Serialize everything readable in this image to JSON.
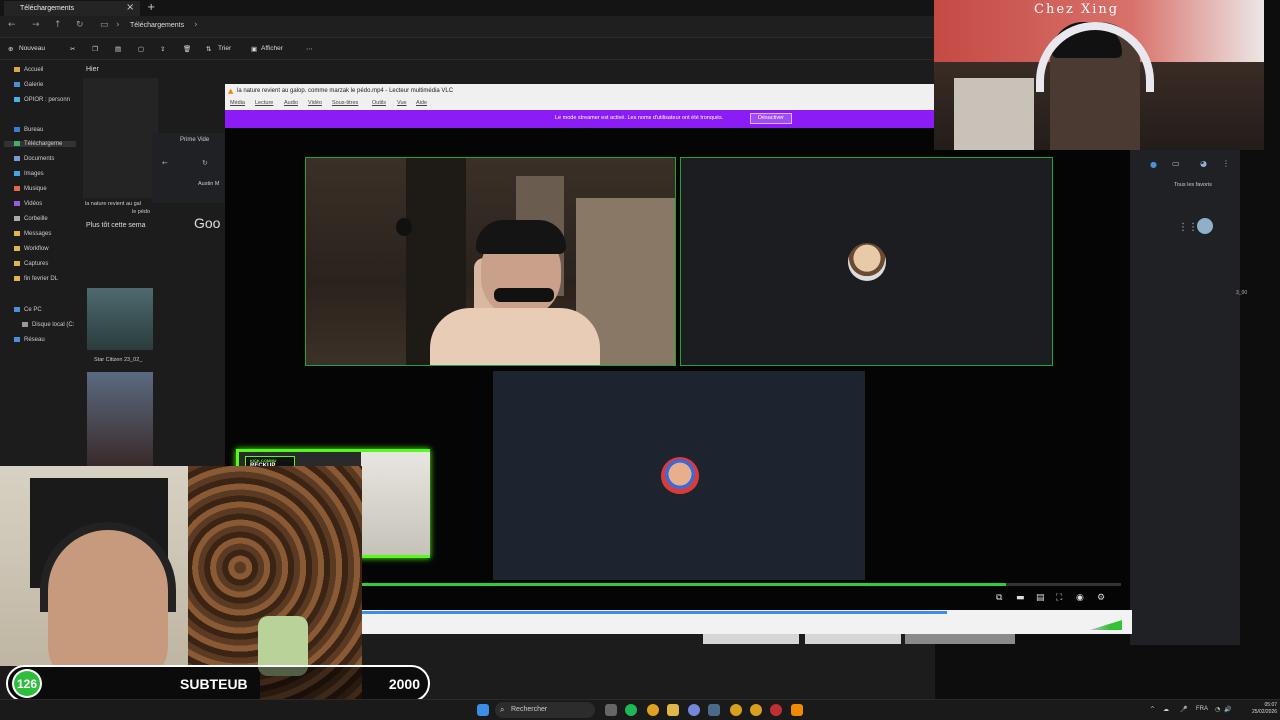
{
  "explorer": {
    "tab_title": "Téléchargements",
    "breadcrumb": "Téléchargements",
    "toolbar": {
      "new_label": "Nouveau",
      "sort_label": "Trier",
      "view_label": "Afficher"
    },
    "sidebar": [
      {
        "label": "Accueil"
      },
      {
        "label": "Galerie"
      },
      {
        "label": "OPIOR : personn"
      },
      {
        "label": "Bureau"
      },
      {
        "label": "Téléchargeme"
      },
      {
        "label": "Documents"
      },
      {
        "label": "Images"
      },
      {
        "label": "Musique"
      },
      {
        "label": "Vidéos"
      },
      {
        "label": "Corbeille"
      },
      {
        "label": "Messages"
      },
      {
        "label": "Workflow"
      },
      {
        "label": "Captures"
      },
      {
        "label": "fin fevrier DL"
      },
      {
        "label": "Ce PC"
      },
      {
        "label": "Disque local (C:"
      },
      {
        "label": "Réseau"
      }
    ],
    "groups": {
      "yesterday": "Hier",
      "earlier_this_week": "Plus tôt cette sema"
    },
    "files": [
      {
        "caption": "la nature revient au gal",
        "caption2": "le pédo"
      },
      {
        "caption": "Star Citizen  23_02_"
      }
    ]
  },
  "chrome": {
    "tab_label": "Prime Vide",
    "bookmark": "Austin M",
    "google_partial": "Goo",
    "all_bookmarks": "Tous les favoris",
    "right_caption": "3_00"
  },
  "vlc": {
    "title": "la nature revient au galop. comme marzak le pédo.mp4 - Lecteur multimédia VLC",
    "menu": [
      "Média",
      "Lecture",
      "Audio",
      "Vidéo",
      "Sous-titres",
      "Outils",
      "Vue",
      "Aide"
    ],
    "banner_message": "Le mode streamer est activé. Les noms d'utilisateur ont été tronqués.",
    "banner_button": "Désactiver",
    "progress_fraction": 0.76
  },
  "overlays": {
    "kick_line1": "KICK COMMU",
    "kick_line2": "RECKUP",
    "webcam_sign": "Chez Xing",
    "sub_goal": {
      "current": "126",
      "label": "SUBTEUB",
      "target": "2000"
    }
  },
  "taskbar": {
    "search_placeholder": "Rechercher",
    "lang": "FRA",
    "time": "05:07",
    "date": "25/02/2026"
  },
  "colors": {
    "accent_green": "#53fc18",
    "banner_purple": "#8b1cf5",
    "goal_green": "#2ebd3c"
  }
}
